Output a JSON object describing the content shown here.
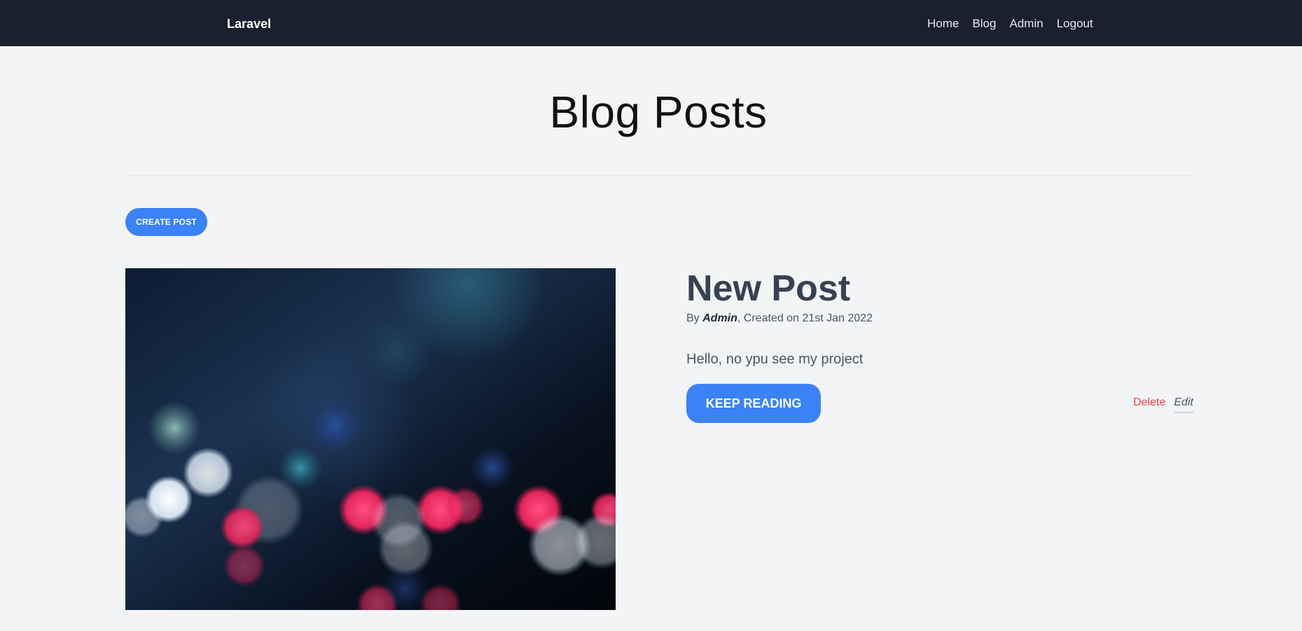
{
  "header": {
    "brand": "Laravel",
    "nav": [
      {
        "label": "Home"
      },
      {
        "label": "Blog"
      },
      {
        "label": "Admin"
      },
      {
        "label": "Logout"
      }
    ],
    "background_color": "#1a202e"
  },
  "main": {
    "title": "Blog Posts",
    "create_button_label": "Create Post",
    "accent_color": "#3b82f6"
  },
  "posts": [
    {
      "title": "New Post",
      "meta_prefix": "By ",
      "author": "Admin",
      "meta_suffix": ", Created on 21st Jan 2022",
      "excerpt": "Hello, no ypu see my project",
      "read_more_label": "Keep Reading",
      "delete_label": "Delete",
      "edit_label": "Edit",
      "image_icon": "bokeh-city-lights-image"
    }
  ]
}
